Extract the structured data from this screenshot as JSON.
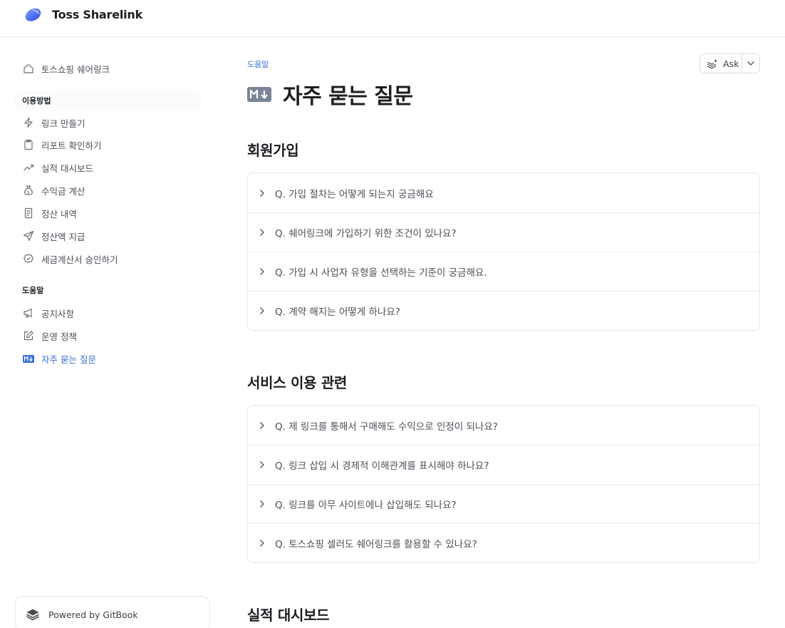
{
  "header": {
    "app_title": "Toss Sharelink"
  },
  "sidebar": {
    "top_item": {
      "label": "토스쇼핑 쉐어링크",
      "icon": "home-icon"
    },
    "sections": [
      {
        "title": "이용방법",
        "items": [
          {
            "label": "링크 만들기",
            "icon": "lightning-icon"
          },
          {
            "label": "리포트 확인하기",
            "icon": "clipboard-icon"
          },
          {
            "label": "실적 대시보드",
            "icon": "trending-up-icon"
          },
          {
            "label": "수익금 계산",
            "icon": "money-bag-icon"
          },
          {
            "label": "정산 내역",
            "icon": "receipt-icon"
          },
          {
            "label": "정산액 지급",
            "icon": "send-icon"
          },
          {
            "label": "세금계산서 승인하기",
            "icon": "badge-check-icon"
          }
        ]
      },
      {
        "title": "도움말",
        "items": [
          {
            "label": "공지사항",
            "icon": "megaphone-icon"
          },
          {
            "label": "운영 정책",
            "icon": "edit-icon"
          },
          {
            "label": "자주 묻는 질문",
            "icon": "markdown-icon"
          }
        ]
      }
    ],
    "powered_by": "Powered by GitBook"
  },
  "main": {
    "breadcrumb": "도움말",
    "title": "자주 묻는 질문",
    "ask_label": "Ask",
    "sections": [
      {
        "heading": "회원가입",
        "questions": [
          "Q. 가입 절차는 어떻게 되는지 궁금해요",
          "Q. 쉐어링크에 가입하기 위한 조건이 있나요?",
          "Q. 가입 시 사업자 유형을 선택하는 기준이 궁금해요.",
          "Q. 계약 해지는 어떻게 하나요?"
        ]
      },
      {
        "heading": "서비스 이용 관련",
        "questions": [
          "Q. 제 링크를 통해서 구매해도 수익으로 인정이 되나요?",
          "Q. 링크 삽입 시 경제적 이해관계를 표시해야 하나요?",
          "Q. 링크를 아무 사이트에나 삽입해도 되나요?",
          "Q. 토스쇼핑 셀러도 쉐어링크를 활용할 수 있나요?"
        ]
      },
      {
        "heading": "실적 대시보드",
        "questions": []
      }
    ]
  },
  "colors": {
    "accent": "#3b6ed9",
    "logo_blue": "#3f62f0",
    "border": "#e3e5e8"
  }
}
